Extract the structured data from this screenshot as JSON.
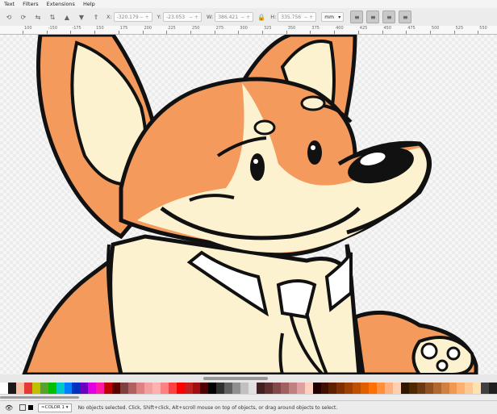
{
  "menu": [
    "Text",
    "Filters",
    "Extensions",
    "Help"
  ],
  "toolbar": {
    "x_label": "X:",
    "x_value": "-320.179",
    "y_label": "Y:",
    "y_value": "-23.053",
    "w_label": "W:",
    "w_value": "386.421",
    "h_label": "H:",
    "h_value": "335.756",
    "unit": "mm",
    "align_buttons": [
      "align-left-icon",
      "align-center-icon",
      "align-right-icon",
      "align-justify-icon"
    ]
  },
  "ruler": [
    "100",
    "-150",
    "-175",
    "150",
    "175",
    "200",
    "225",
    "250",
    "275",
    "300",
    "325",
    "350",
    "375",
    "400",
    "425",
    "450",
    "475",
    "500",
    "525",
    "550",
    "575"
  ],
  "palette": [
    "#ffffff",
    "#1a1a1a",
    "#f5c0a8",
    "#e53935",
    "#c0c000",
    "#5aa02c",
    "#00c000",
    "#00c8c8",
    "#0080ff",
    "#0030c0",
    "#7000c0",
    "#e000e0",
    "#ff1aa0",
    "#c00000",
    "#5a0000",
    "#804040",
    "#b06060",
    "#e08080",
    "#f0a0a0",
    "#ffb0b0",
    "#ff8080",
    "#ff4040",
    "#ff0000",
    "#c02020",
    "#a01010",
    "#500000",
    "#000000",
    "#303030",
    "#606060",
    "#909090",
    "#c0c0c0",
    "#e0e0e0",
    "#402020",
    "#603030",
    "#804848",
    "#a06060",
    "#c08080",
    "#e0a0a0",
    "#ffd0c0",
    "#200000",
    "#401000",
    "#602000",
    "#803000",
    "#a04000",
    "#c05000",
    "#e06000",
    "#ff7000",
    "#ff9040",
    "#ffb080",
    "#ffd0b0",
    "#301800",
    "#502800",
    "#703810",
    "#905020",
    "#b06830",
    "#d08040",
    "#f09850",
    "#ffb070",
    "#ffc890",
    "#ffe0b0",
    "#404040",
    "#202020"
  ],
  "status": {
    "color_label": "≈COLOR 1",
    "message": "No objects selected. Click, Shift+click, Alt+scroll mouse on top of objects, or drag around objects to select."
  }
}
